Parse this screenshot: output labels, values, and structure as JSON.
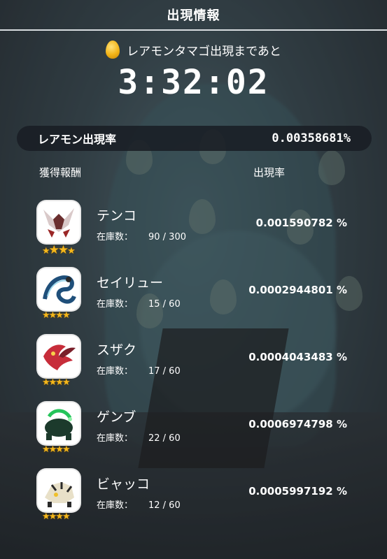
{
  "header": {
    "title": "出現情報"
  },
  "countdown": {
    "label": "レアモンタマゴ出現まであと",
    "time": "3:32:02"
  },
  "rare_rate": {
    "label": "レアモン出現率",
    "value": "0.00358681%"
  },
  "columns": {
    "reward": "獲得報酬",
    "rate": "出現率"
  },
  "stock_label": "在庫数：",
  "items": [
    {
      "name": "テンコ",
      "stock": "90 / 300",
      "rate": "0.001590782 %",
      "stars": 3,
      "color": "#b12a2a"
    },
    {
      "name": "セイリュー",
      "stock": "15 / 60",
      "rate": "0.0002944801 %",
      "stars": 4,
      "color": "#1f6f8b"
    },
    {
      "name": "スザク",
      "stock": "17 / 60",
      "rate": "0.0004043483 %",
      "stars": 4,
      "color": "#c72d3a"
    },
    {
      "name": "ゲンブ",
      "stock": "22 / 60",
      "rate": "0.0006974798 %",
      "stars": 4,
      "color": "#1d8a3a"
    },
    {
      "name": "ビャッコ",
      "stock": "12 / 60",
      "rate": "0.0005997192 %",
      "stars": 4,
      "color": "#d6a21a"
    }
  ]
}
